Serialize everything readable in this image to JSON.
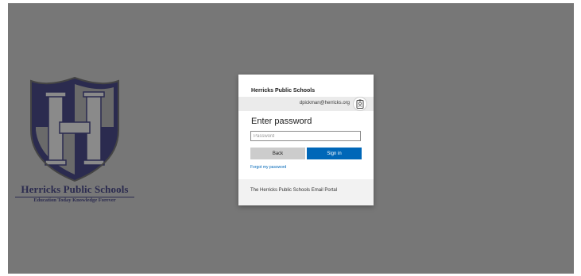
{
  "colors": {
    "backdrop": "#777777",
    "primary_button": "#0067b8",
    "secondary_button": "#cccccc",
    "logo_navy": "#2b2b4f"
  },
  "logo": {
    "icon": "shield-h-crest-icon",
    "name": "Herricks Public Schools",
    "tagline": "Education Today  Knowledge Forever"
  },
  "dialog": {
    "org_name": "Herricks Public Schools",
    "identity": {
      "email": "dpickman@herricks.org",
      "icon": "id-badge-icon"
    },
    "title": "Enter password",
    "password": {
      "placeholder": "Password",
      "value": ""
    },
    "back_label": "Back",
    "signin_label": "Sign in",
    "forgot_label": "Forgot my password",
    "footer_text": "The Herricks Public Schools Email Portal"
  }
}
